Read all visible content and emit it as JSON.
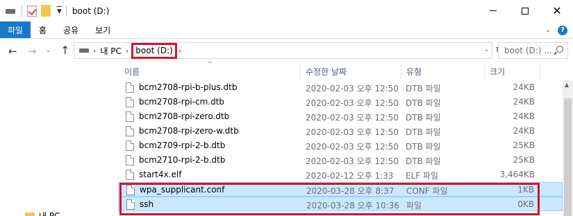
{
  "window": {
    "title": "boot (D:)"
  },
  "ribbon": {
    "file_tab": "파일",
    "tabs": [
      "홈",
      "공유",
      "보기"
    ],
    "help": "?"
  },
  "address": {
    "crumbs": [
      "내 PC",
      "boot (D:)"
    ],
    "search_placeholder": "boot (D:) ..."
  },
  "columns": {
    "name": "이름",
    "date": "수정한 날짜",
    "type": "유형",
    "size": "크기"
  },
  "files": [
    {
      "name": "bcm2708-rpi-b-plus.dtb",
      "date": "2020-02-03 오후 12:50",
      "type": "DTB 파일",
      "size": "24KB",
      "selected": false
    },
    {
      "name": "bcm2708-rpi-cm.dtb",
      "date": "2020-02-03 오후 12:50",
      "type": "DTB 파일",
      "size": "24KB",
      "selected": false
    },
    {
      "name": "bcm2708-rpi-zero.dtb",
      "date": "2020-02-03 오후 12:50",
      "type": "DTB 파일",
      "size": "24KB",
      "selected": false
    },
    {
      "name": "bcm2708-rpi-zero-w.dtb",
      "date": "2020-02-03 오후 12:50",
      "type": "DTB 파일",
      "size": "24KB",
      "selected": false
    },
    {
      "name": "bcm2709-rpi-2-b.dtb",
      "date": "2020-02-03 오후 12:50",
      "type": "DTB 파일",
      "size": "25KB",
      "selected": false
    },
    {
      "name": "bcm2710-rpi-2-b.dtb",
      "date": "2020-02-03 오후 12:50",
      "type": "DTB 파일",
      "size": "25KB",
      "selected": false
    },
    {
      "name": "start4x.elf",
      "date": "2020-02-12 오후 1:33",
      "type": "ELF 파일",
      "size": "3,464KB",
      "selected": false
    },
    {
      "name": "wpa_supplicant.conf",
      "date": "2020-03-28 오후 8:37",
      "type": "CONF 파일",
      "size": "1KB",
      "selected": true
    },
    {
      "name": "ssh",
      "date": "2020-03-28 오후 10:36",
      "type": "파일",
      "size": "0KB",
      "selected": true
    }
  ],
  "navpane": {
    "partial_label": "내 PC"
  },
  "colors": {
    "accent": "#1979ca",
    "highlight": "#d3152a",
    "selection": "#cce8ff"
  }
}
